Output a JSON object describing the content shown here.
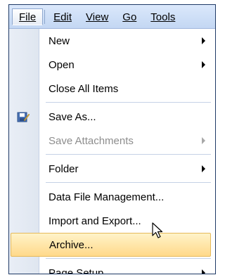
{
  "menubar": {
    "items": [
      {
        "label": "File"
      },
      {
        "label": "Edit"
      },
      {
        "label": "View"
      },
      {
        "label": "Go"
      },
      {
        "label": "Tools"
      }
    ]
  },
  "file_menu": {
    "items": [
      {
        "label": "New",
        "has_submenu": true
      },
      {
        "label": "Open",
        "has_submenu": true
      },
      {
        "label": "Close All Items"
      },
      {
        "label": "Save As..."
      },
      {
        "label": "Save Attachments",
        "has_submenu": true,
        "disabled": true
      },
      {
        "label": "Folder",
        "has_submenu": true
      },
      {
        "label": "Data File Management..."
      },
      {
        "label": "Import and Export..."
      },
      {
        "label": "Archive...",
        "highlighted": true
      },
      {
        "label": "Page Setup",
        "has_submenu": true
      }
    ]
  },
  "icons": {
    "save_as": "save-as-icon",
    "cursor": "mouse-pointer-icon"
  },
  "colors": {
    "menubar_bg": "#c3d7f3",
    "highlight": "#ffd98a",
    "disabled_text": "#8d8d8d"
  }
}
